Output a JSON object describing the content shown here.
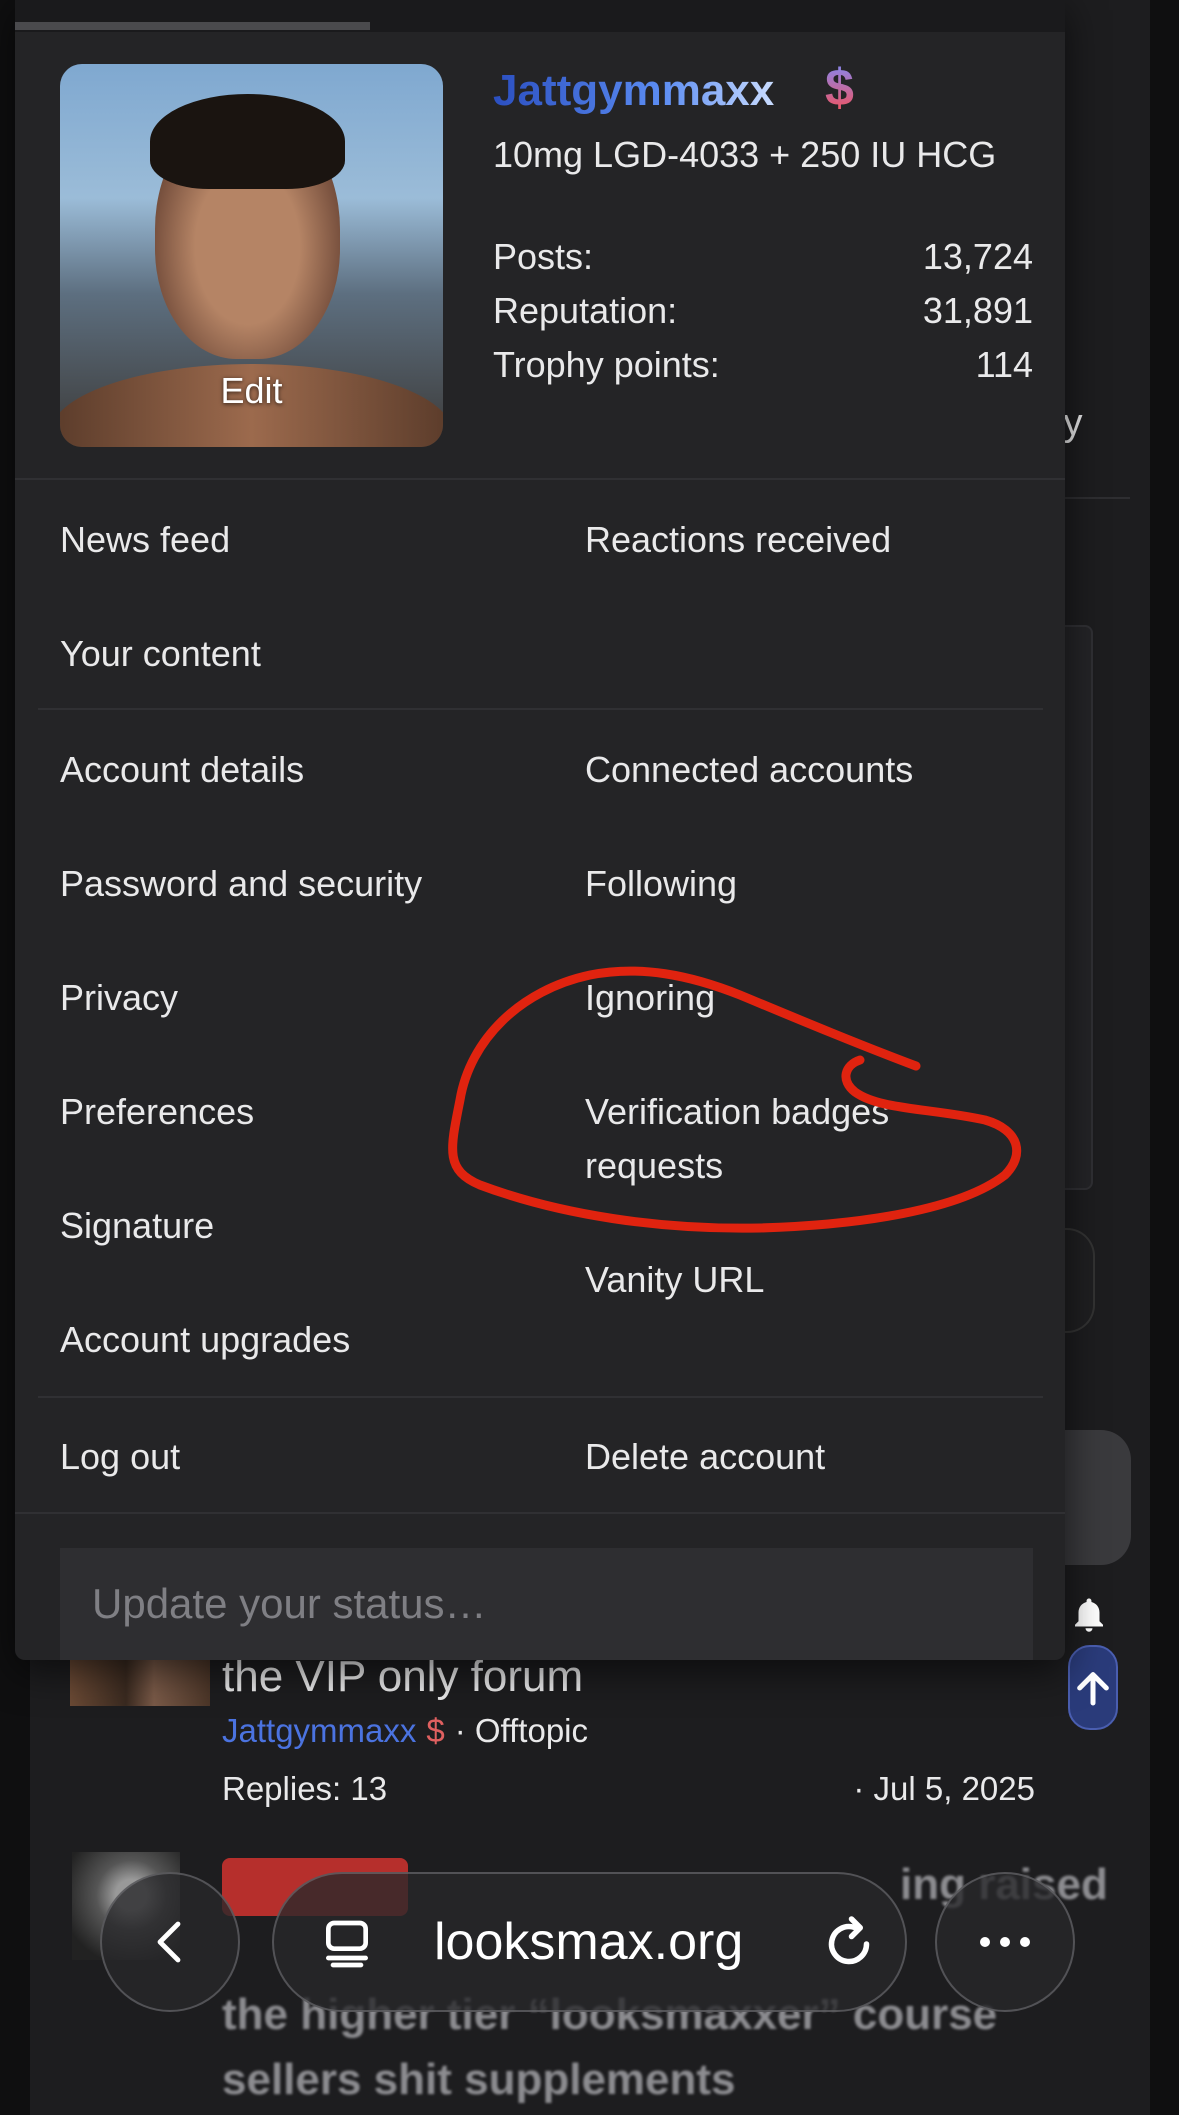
{
  "profile": {
    "avatar_edit_label": "Edit",
    "username": "Jattgymmaxx",
    "user_title": "10mg LGD-4033 + 250 IU HCG",
    "stats": [
      {
        "label": "Posts:",
        "value": "13,724"
      },
      {
        "label": "Reputation:",
        "value": "31,891"
      },
      {
        "label": "Trophy points:",
        "value": "114"
      }
    ]
  },
  "menu": {
    "section1": {
      "left": [
        "News feed",
        "Your content"
      ],
      "right": [
        "Reactions received"
      ]
    },
    "section2": {
      "left": [
        "Account details",
        "Password and security",
        "Privacy",
        "Preferences",
        "Signature",
        "Account upgrades"
      ],
      "right": [
        "Connected accounts",
        "Following",
        "Ignoring",
        "Verification badges requests",
        "Vanity URL"
      ]
    },
    "section3": {
      "left": [
        "Log out"
      ],
      "right": [
        "Delete account"
      ]
    },
    "status_placeholder": "Update your status…"
  },
  "background": {
    "edge_text": "ly",
    "thread1": {
      "title": "the VIP only forum",
      "author": "Jattgymmaxx",
      "forum": "· Offtopic",
      "replies": "Replies: 13",
      "date": "· Jul 5, 2025"
    },
    "thread2_lines": [
      "ing raised",
      "the higher tier “looksmaxxer” course",
      "sellers shit supplements"
    ]
  },
  "browser": {
    "url": "looksmax.org"
  },
  "colors": {
    "menu_bg": "#242426",
    "annotation": "#e0230f",
    "scroll_top_btn": "#2a3b7a"
  },
  "icons": [
    "dollar-icon",
    "bell-icon",
    "arrow-up-icon",
    "back-chevron-icon",
    "reader-mode-icon",
    "reload-icon",
    "more-icon"
  ]
}
